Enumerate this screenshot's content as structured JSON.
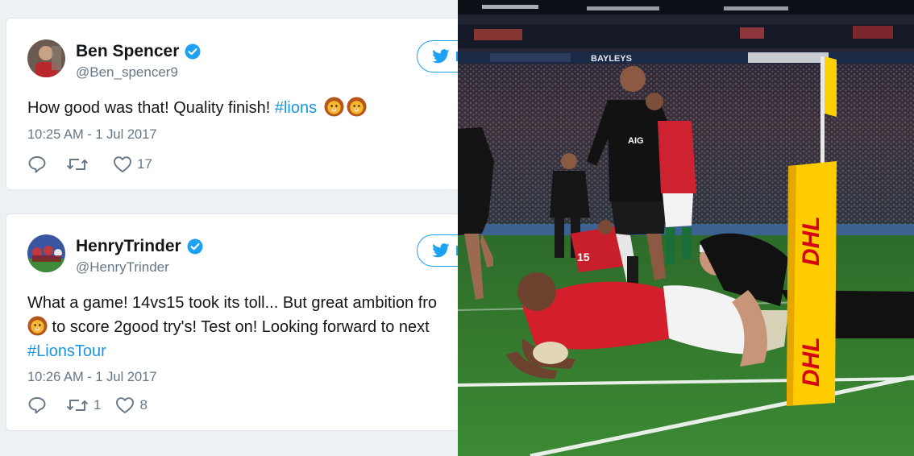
{
  "tweets": [
    {
      "name": "Ben Spencer",
      "handle": "@Ben_spencer9",
      "text_main": "How good was that! Quality finish! ",
      "hashtag": "#lions",
      "timestamp": "10:25 AM - 1 Jul 2017",
      "retweets": "",
      "likes": "17"
    },
    {
      "name": "HenryTrinder",
      "handle": "@HenryTrinder",
      "line1": "What a game! 14vs15 took its toll... But great ambition fro",
      "line2": " to score 2good try's! Test on! Looking forward to next",
      "hashtag": "#LionsTour",
      "timestamp": "10:26 AM - 1 Jul 2017",
      "retweets": "1",
      "likes": "8"
    }
  ],
  "photo": {
    "shirt_sponsor": "AIG",
    "stadium_boards": [
      "BAYLEYS"
    ],
    "flag_brand": "DHL",
    "player_number": "15"
  },
  "colors": {
    "twitter_blue": "#1da1f2",
    "hashtag": "#1b95e0",
    "muted": "#657786",
    "lions_red": "#d21f2b",
    "all_blacks": "#111111",
    "pitch_green": "#2f7a2a",
    "dhl_yellow": "#ffcc00"
  },
  "icons": [
    "verified-badge-icon",
    "twitter-bird-icon",
    "reply-icon",
    "retweet-icon",
    "like-icon",
    "lion-emoji-icon"
  ]
}
